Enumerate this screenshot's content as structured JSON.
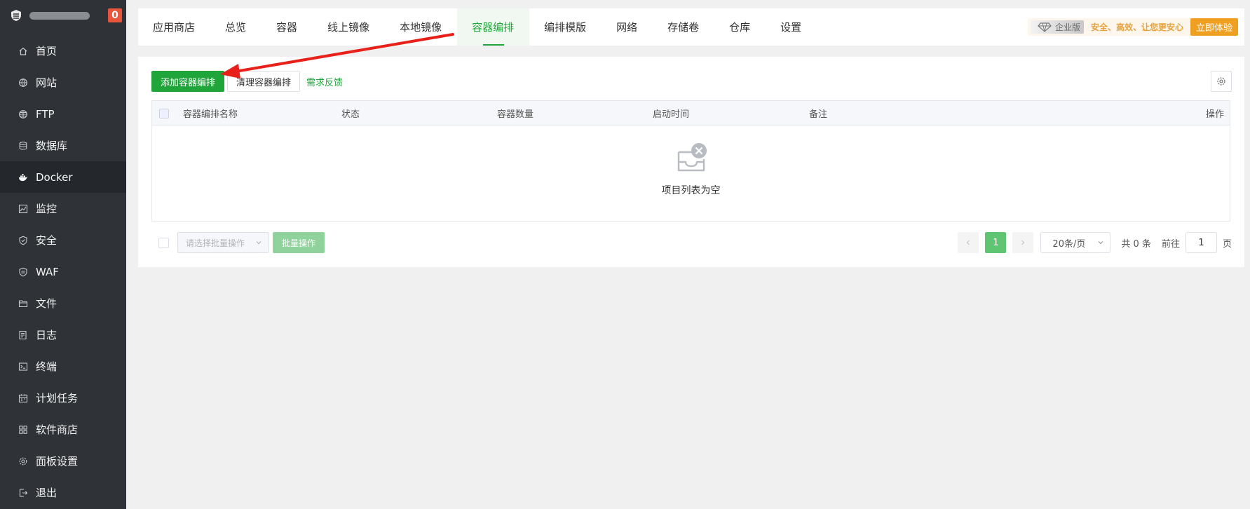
{
  "sidebar": {
    "notification_count": "0",
    "items": [
      {
        "label": "首页",
        "icon": "home-icon"
      },
      {
        "label": "网站",
        "icon": "globe-icon"
      },
      {
        "label": "FTP",
        "icon": "ftp-globe-icon"
      },
      {
        "label": "数据库",
        "icon": "database-icon"
      },
      {
        "label": "Docker",
        "icon": "docker-icon"
      },
      {
        "label": "监控",
        "icon": "monitor-icon"
      },
      {
        "label": "安全",
        "icon": "shield-icon"
      },
      {
        "label": "WAF",
        "icon": "waf-shield-icon"
      },
      {
        "label": "文件",
        "icon": "folder-icon"
      },
      {
        "label": "日志",
        "icon": "log-icon"
      },
      {
        "label": "终端",
        "icon": "terminal-icon"
      },
      {
        "label": "计划任务",
        "icon": "calendar-icon"
      },
      {
        "label": "软件商店",
        "icon": "grid-icon"
      },
      {
        "label": "面板设置",
        "icon": "gear-icon"
      },
      {
        "label": "退出",
        "icon": "logout-icon"
      }
    ],
    "active_item": "Docker"
  },
  "tabs": {
    "items": [
      "应用商店",
      "总览",
      "容器",
      "线上镜像",
      "本地镜像",
      "容器编排",
      "编排模版",
      "网络",
      "存储卷",
      "仓库",
      "设置"
    ],
    "active": "容器编排"
  },
  "promo": {
    "badge": "企业版",
    "text": "安全、高效、让您更安心",
    "button": "立即体验"
  },
  "toolbar": {
    "add_label": "添加容器编排",
    "clear_label": "清理容器编排",
    "feedback_label": "需求反馈"
  },
  "table": {
    "columns": [
      "容器编排名称",
      "状态",
      "容器数量",
      "启动时间",
      "备注",
      "操作"
    ],
    "rows": [],
    "empty_text": "项目列表为空"
  },
  "footer": {
    "batch_placeholder": "请选择批量操作",
    "batch_button": "批量操作",
    "current_page": "1",
    "page_size": "20条/页",
    "total": "共 0 条",
    "jump_prefix": "前往",
    "jump_value": "1",
    "jump_suffix": "页"
  },
  "colors": {
    "accent": "#20a53a",
    "sidebar_bg": "#2f3338",
    "promo": "#f0a020",
    "annotation_arrow": "#e8201a"
  }
}
